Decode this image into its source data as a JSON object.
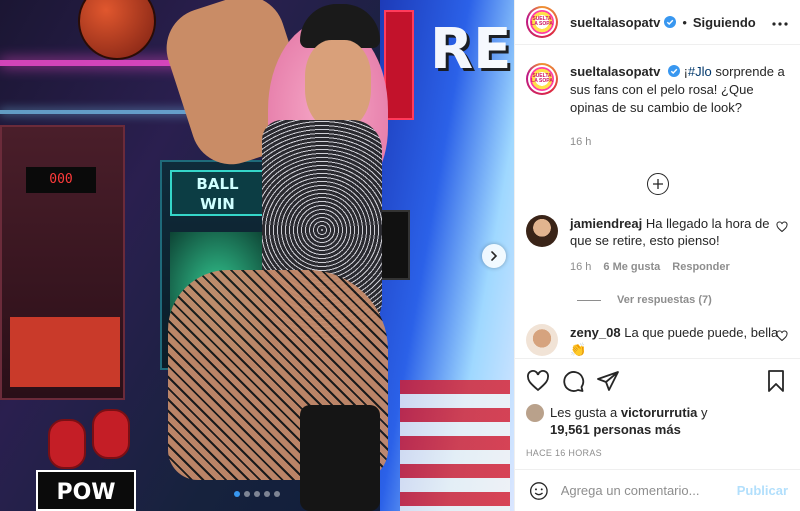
{
  "media": {
    "machine_score": "000",
    "ball_win_line1": "BALL",
    "ball_win_line2": "WIN",
    "bigtext": "RED",
    "pow_text": "POW",
    "carousel": {
      "total": 5,
      "active_index": 0
    },
    "next_icon": "chevron-right-icon"
  },
  "header": {
    "username": "sueltalasopatv",
    "separator": "•",
    "follow_label": "Siguiendo",
    "more_icon": "more-horizontal-icon",
    "avatar_text": "SUELTA LA SOPA"
  },
  "caption": {
    "username": "sueltalasopatv",
    "hashtag": "#Jlo",
    "text": " sorprende a sus fans con el pelo rosa! ¿Que opinas de su cambio de look?",
    "prefix": "¡",
    "time": "16 h"
  },
  "comments": [
    {
      "username": "jamiendreaj",
      "text": "Ha llegado la hora de que se retire, esto pienso!",
      "time": "16 h",
      "likes": "6 Me gusta",
      "reply_label": "Responder",
      "view_replies": "Ver respuestas (7)"
    },
    {
      "username": "zeny_08",
      "text": "La que puede puede, bella 👏"
    }
  ],
  "actions": {
    "like_icon": "heart-icon",
    "comment_icon": "comment-icon",
    "share_icon": "share-icon",
    "save_icon": "bookmark-icon",
    "likes_prefix": "Les gusta a",
    "likes_user": "victorurrutia",
    "likes_suffix": " y",
    "likes_count": "19,561 personas más",
    "ago": "HACE 16 HORAS"
  },
  "add_comment": {
    "emoji_icon": "emoji-icon",
    "placeholder": "Agrega un comentario...",
    "publish_label": "Publicar"
  },
  "colors": {
    "verified": "#3897f0",
    "link": "#00376b",
    "muted": "#8e8e8e",
    "publish_disabled": "#b2dffc"
  }
}
